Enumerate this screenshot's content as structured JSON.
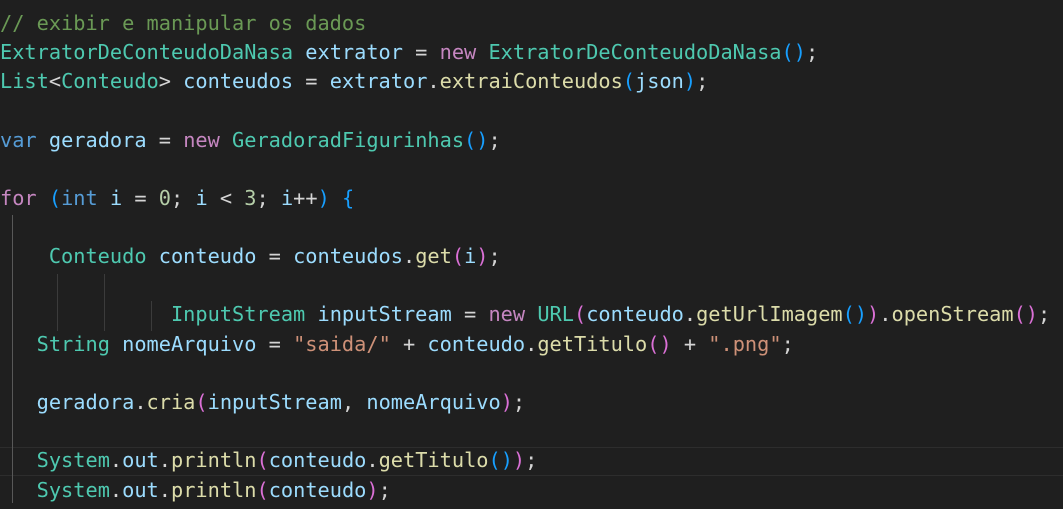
{
  "editor": {
    "language": "java",
    "theme": "dark",
    "colors": {
      "background": "#1f1f1f",
      "comment": "#6a9955",
      "class": "#4ec9b0",
      "variable": "#9cdcfe",
      "keyword": "#c586c0",
      "type": "#569cd6",
      "function": "#dcdcaa",
      "string": "#ce9178",
      "number": "#b5cea8",
      "bracket_gold": "#ffd700",
      "bracket_orchid": "#da70d6",
      "bracket_blue": "#179fff"
    },
    "lines": [
      [
        {
          "t": "comment",
          "v": "// exibir e manipular os dados"
        }
      ],
      [
        {
          "t": "class",
          "v": "ExtratorDeConteudoDaNasa"
        },
        {
          "t": "op",
          "v": " "
        },
        {
          "t": "var",
          "v": "extrator"
        },
        {
          "t": "op",
          "v": " = "
        },
        {
          "t": "keyword",
          "v": "new"
        },
        {
          "t": "op",
          "v": " "
        },
        {
          "t": "class",
          "v": "ExtratorDeConteudoDaNasa"
        },
        {
          "t": "brace-3",
          "v": "()"
        },
        {
          "t": "op",
          "v": ";"
        }
      ],
      [
        {
          "t": "class",
          "v": "List"
        },
        {
          "t": "op",
          "v": "<"
        },
        {
          "t": "class",
          "v": "Conteudo"
        },
        {
          "t": "op",
          "v": "> "
        },
        {
          "t": "var",
          "v": "conteudos"
        },
        {
          "t": "op",
          "v": " = "
        },
        {
          "t": "var",
          "v": "extrator"
        },
        {
          "t": "op",
          "v": "."
        },
        {
          "t": "func",
          "v": "extraiConteudos"
        },
        {
          "t": "brace-3",
          "v": "("
        },
        {
          "t": "var",
          "v": "json"
        },
        {
          "t": "brace-3",
          "v": ")"
        },
        {
          "t": "op",
          "v": ";"
        }
      ],
      [],
      [
        {
          "t": "type",
          "v": "var"
        },
        {
          "t": "op",
          "v": " "
        },
        {
          "t": "var",
          "v": "geradora"
        },
        {
          "t": "op",
          "v": " = "
        },
        {
          "t": "keyword",
          "v": "new"
        },
        {
          "t": "op",
          "v": " "
        },
        {
          "t": "class",
          "v": "GeradoradFigurinhas"
        },
        {
          "t": "brace-3",
          "v": "()"
        },
        {
          "t": "op",
          "v": ";"
        }
      ],
      [],
      [
        {
          "t": "keyword",
          "v": "for"
        },
        {
          "t": "op",
          "v": " "
        },
        {
          "t": "brace-3",
          "v": "("
        },
        {
          "t": "type",
          "v": "int"
        },
        {
          "t": "op",
          "v": " "
        },
        {
          "t": "var",
          "v": "i"
        },
        {
          "t": "op",
          "v": " = "
        },
        {
          "t": "number",
          "v": "0"
        },
        {
          "t": "op",
          "v": "; "
        },
        {
          "t": "var",
          "v": "i"
        },
        {
          "t": "op",
          "v": " < "
        },
        {
          "t": "number",
          "v": "3"
        },
        {
          "t": "op",
          "v": "; "
        },
        {
          "t": "var",
          "v": "i"
        },
        {
          "t": "op",
          "v": "++"
        },
        {
          "t": "brace-3",
          "v": ")"
        },
        {
          "t": "op",
          "v": " "
        },
        {
          "t": "brace-3",
          "v": "{"
        }
      ],
      [],
      [
        {
          "t": "op",
          "v": "    "
        },
        {
          "t": "class",
          "v": "Conteudo"
        },
        {
          "t": "op",
          "v": " "
        },
        {
          "t": "var",
          "v": "conteudo"
        },
        {
          "t": "op",
          "v": " = "
        },
        {
          "t": "var",
          "v": "conteudos"
        },
        {
          "t": "op",
          "v": "."
        },
        {
          "t": "func",
          "v": "get"
        },
        {
          "t": "brace-2",
          "v": "("
        },
        {
          "t": "var",
          "v": "i"
        },
        {
          "t": "brace-2",
          "v": ")"
        },
        {
          "t": "op",
          "v": ";"
        }
      ],
      [],
      [
        {
          "t": "op",
          "v": "              "
        },
        {
          "t": "class",
          "v": "InputStream"
        },
        {
          "t": "op",
          "v": " "
        },
        {
          "t": "var",
          "v": "inputStream"
        },
        {
          "t": "op",
          "v": " = "
        },
        {
          "t": "keyword",
          "v": "new"
        },
        {
          "t": "op",
          "v": " "
        },
        {
          "t": "class",
          "v": "URL"
        },
        {
          "t": "brace-2",
          "v": "("
        },
        {
          "t": "var",
          "v": "conteudo"
        },
        {
          "t": "op",
          "v": "."
        },
        {
          "t": "func",
          "v": "getUrlImagem"
        },
        {
          "t": "brace-3",
          "v": "()"
        },
        {
          "t": "brace-2",
          "v": ")"
        },
        {
          "t": "op",
          "v": "."
        },
        {
          "t": "func",
          "v": "openStream"
        },
        {
          "t": "brace-2",
          "v": "()"
        },
        {
          "t": "op",
          "v": ";"
        }
      ],
      [
        {
          "t": "op",
          "v": "   "
        },
        {
          "t": "class",
          "v": "String"
        },
        {
          "t": "op",
          "v": " "
        },
        {
          "t": "var",
          "v": "nomeArquivo"
        },
        {
          "t": "op",
          "v": " = "
        },
        {
          "t": "string",
          "v": "\"saida/\""
        },
        {
          "t": "op",
          "v": " + "
        },
        {
          "t": "var",
          "v": "conteudo"
        },
        {
          "t": "op",
          "v": "."
        },
        {
          "t": "func",
          "v": "getTitulo"
        },
        {
          "t": "brace-2",
          "v": "()"
        },
        {
          "t": "op",
          "v": " + "
        },
        {
          "t": "string",
          "v": "\".png\""
        },
        {
          "t": "op",
          "v": ";"
        }
      ],
      [],
      [
        {
          "t": "op",
          "v": "   "
        },
        {
          "t": "var",
          "v": "geradora"
        },
        {
          "t": "op",
          "v": "."
        },
        {
          "t": "func",
          "v": "cria"
        },
        {
          "t": "brace-2",
          "v": "("
        },
        {
          "t": "var",
          "v": "inputStream"
        },
        {
          "t": "op",
          "v": ", "
        },
        {
          "t": "var",
          "v": "nomeArquivo"
        },
        {
          "t": "brace-2",
          "v": ")"
        },
        {
          "t": "op",
          "v": ";"
        }
      ],
      [],
      [
        {
          "t": "op",
          "v": "   "
        },
        {
          "t": "class",
          "v": "System"
        },
        {
          "t": "op",
          "v": "."
        },
        {
          "t": "var",
          "v": "out"
        },
        {
          "t": "op",
          "v": "."
        },
        {
          "t": "func",
          "v": "println"
        },
        {
          "t": "brace-2",
          "v": "("
        },
        {
          "t": "var",
          "v": "conteudo"
        },
        {
          "t": "op",
          "v": "."
        },
        {
          "t": "func",
          "v": "getTitulo"
        },
        {
          "t": "brace-3",
          "v": "()"
        },
        {
          "t": "brace-2",
          "v": ")"
        },
        {
          "t": "op",
          "v": ";"
        }
      ],
      [
        {
          "t": "op",
          "v": "   "
        },
        {
          "t": "class",
          "v": "System"
        },
        {
          "t": "op",
          "v": "."
        },
        {
          "t": "var",
          "v": "out"
        },
        {
          "t": "op",
          "v": "."
        },
        {
          "t": "func",
          "v": "println"
        },
        {
          "t": "brace-2",
          "v": "("
        },
        {
          "t": "var",
          "v": "conteudo"
        },
        {
          "t": "brace-2",
          "v": ")"
        },
        {
          "t": "op",
          "v": ";"
        }
      ]
    ]
  }
}
